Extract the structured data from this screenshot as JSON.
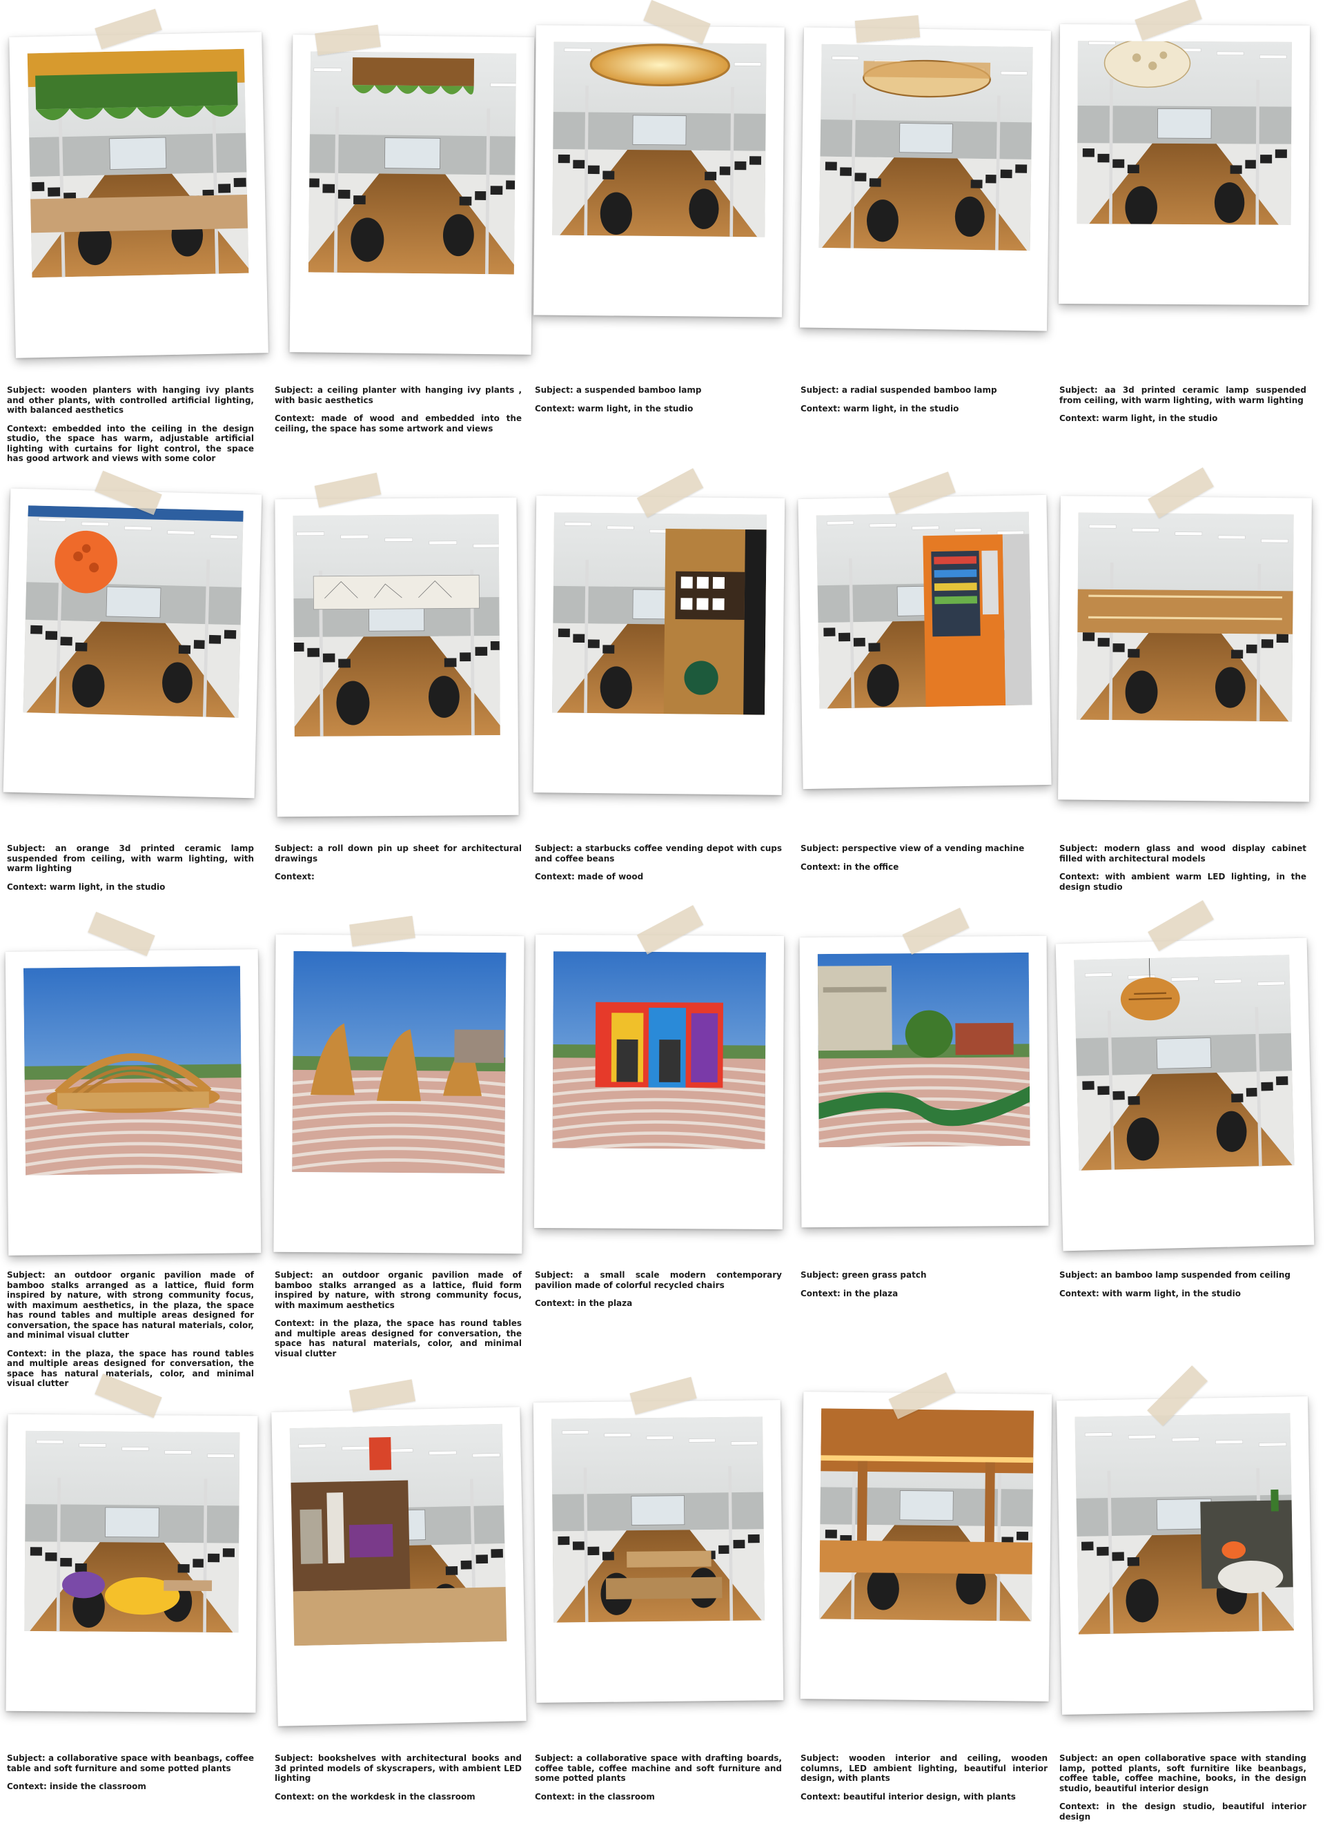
{
  "cards": [
    {
      "subject": "Subject: wooden planters with hanging ivy plants and other plants, with controlled artificial lighting, with balanced aesthetics",
      "context": "Context: embedded into the ceiling in the design studio, the space has warm, adjustable artificial lighting with curtains for light control, the space has good artwork and views with some color"
    },
    {
      "subject": "Subject: a ceiling planter with hanging ivy plants , with basic aesthetics",
      "context": "Context: made of wood and embedded into the ceiling, the space has some artwork and views"
    },
    {
      "subject": "Subject: a suspended bamboo lamp",
      "context": "Context: warm light, in the studio"
    },
    {
      "subject": "Subject: a radial suspended bamboo lamp",
      "context": "Context: warm light, in the studio"
    },
    {
      "subject": "Subject: aa 3d printed ceramic lamp suspended from ceiling, with warm lighting, with warm lighting",
      "context": "Context: warm light, in the studio"
    },
    {
      "subject": "Subject: an orange 3d printed ceramic lamp suspended from ceiling, with warm lighting, with warm lighting",
      "context": "Context: warm light, in the studio"
    },
    {
      "subject": "Subject: a roll down pin up sheet for architectural drawings",
      "context": "Context:"
    },
    {
      "subject": "Subject: a starbucks coffee vending depot with cups and coffee beans",
      "context": "Context: made of wood"
    },
    {
      "subject": "Subject: perspective view of a vending machine",
      "context": "Context: in the office"
    },
    {
      "subject": "Subject: modern glass and wood display cabinet filled with architectural models",
      "context": "Context: with ambient warm LED lighting, in the design studio"
    },
    {
      "subject": "Subject: an outdoor organic pavilion made of bamboo stalks arranged as a lattice, fluid form inspired by nature, with strong community focus, with maximum aesthetics, in the plaza, the space has round tables and multiple areas designed for conversation, the space has natural materials, color, and minimal visual clutter",
      "context": "Context: in the plaza, the space has round tables and multiple areas designed for conversation, the space has natural materials, color, and minimal visual clutter"
    },
    {
      "subject": "Subject: an outdoor organic pavilion made of bamboo stalks arranged as a lattice, fluid form inspired by nature, with strong community focus, with maximum aesthetics",
      "context": "Context: in the plaza, the space has round tables and multiple areas designed for conversation, the space has natural materials, color, and minimal visual clutter"
    },
    {
      "subject": "Subject: a small scale modern contemporary pavilion made of colorful recycled chairs",
      "context": "Context:  in the plaza"
    },
    {
      "subject": "Subject: green grass patch",
      "context": "Context: in the plaza"
    },
    {
      "subject": "Subject: an bamboo lamp suspended from ceiling",
      "context": "Context: with warm light, in the studio"
    },
    {
      "subject": "Subject: a collaborative space with beanbags, coffee table and soft furniture and some potted plants",
      "context": "Context: inside the classroom"
    },
    {
      "subject": "Subject: bookshelves with architectural books and 3d printed models of skyscrapers, with ambient LED lighting",
      "context": "Context: on the workdesk in the classroom"
    },
    {
      "subject": "Subject: a collaborative space with drafting boards, coffee table, coffee machine and soft furniture and some potted plants",
      "context": "Context:  in the classroom"
    },
    {
      "subject": "Subject: wooden interior and ceiling, wooden columns, LED ambient lighting, beautiful interior design, with plants",
      "context": "Context: beautiful interior design, with plants"
    },
    {
      "subject": "Subject: an open collaborative space with standing lamp, potted plants, soft furnitire like beanbags, coffee table, coffee machine, books, in the design studio, beautiful interior design",
      "context": "Context: in the design studio, beautiful interior design"
    }
  ],
  "colors": {
    "paper": "#ffffff",
    "tape": "#e0d2ba",
    "text": "#1e1e1e",
    "floor": "#b07a3c",
    "ceiling": "#eef0f0",
    "wall": "#d6d8d6",
    "sky": "#3f7fd0",
    "brick": "#c98a7c"
  }
}
